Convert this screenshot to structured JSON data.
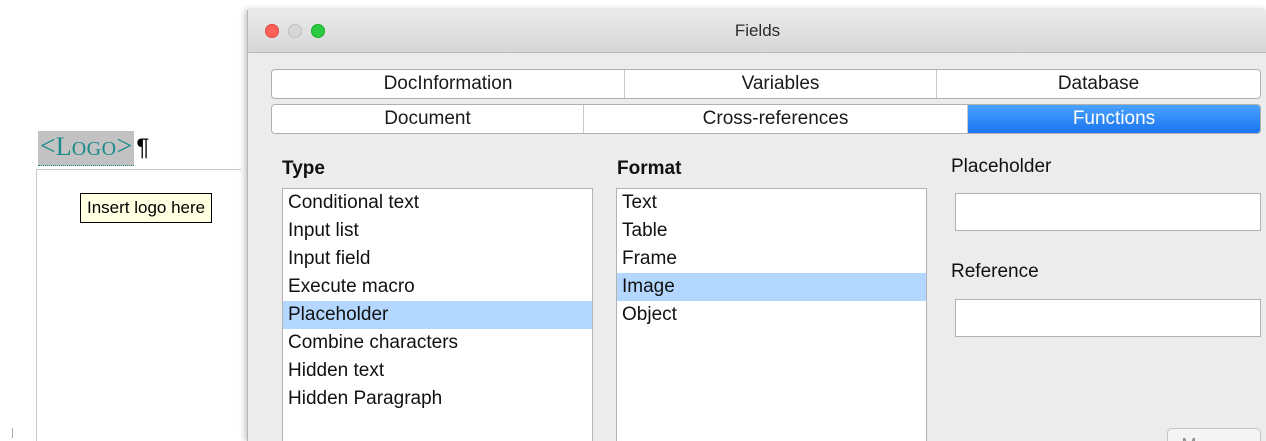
{
  "document": {
    "field": {
      "open_bracket": "<",
      "text_first": "L",
      "text_rest": "OGO",
      "close_bracket": ">"
    },
    "pilcrow": "¶",
    "tooltip": "Insert logo here"
  },
  "dialog": {
    "title": "Fields",
    "tabs_row1": [
      {
        "label": "DocInformation"
      },
      {
        "label": "Variables"
      },
      {
        "label": "Database"
      }
    ],
    "tabs_row2": [
      {
        "label": "Document"
      },
      {
        "label": "Cross-references"
      },
      {
        "label": "Functions",
        "selected": true
      }
    ],
    "type": {
      "label": "Type",
      "items": [
        "Conditional text",
        "Input list",
        "Input field",
        "Execute macro",
        "Placeholder",
        "Combine characters",
        "Hidden text",
        "Hidden Paragraph"
      ],
      "selected": "Placeholder"
    },
    "format": {
      "label": "Format",
      "items": [
        "Text",
        "Table",
        "Frame",
        "Image",
        "Object"
      ],
      "selected": "Image"
    },
    "placeholder": {
      "label": "Placeholder",
      "value": ""
    },
    "reference": {
      "label": "Reference",
      "value": ""
    },
    "macro_button": "Macro..."
  },
  "colors": {
    "selected_tab": "#1a74f0",
    "list_selection": "#b3d7ff",
    "field_text": "#1b8a8a",
    "tooltip_bg": "#ffffe1"
  }
}
